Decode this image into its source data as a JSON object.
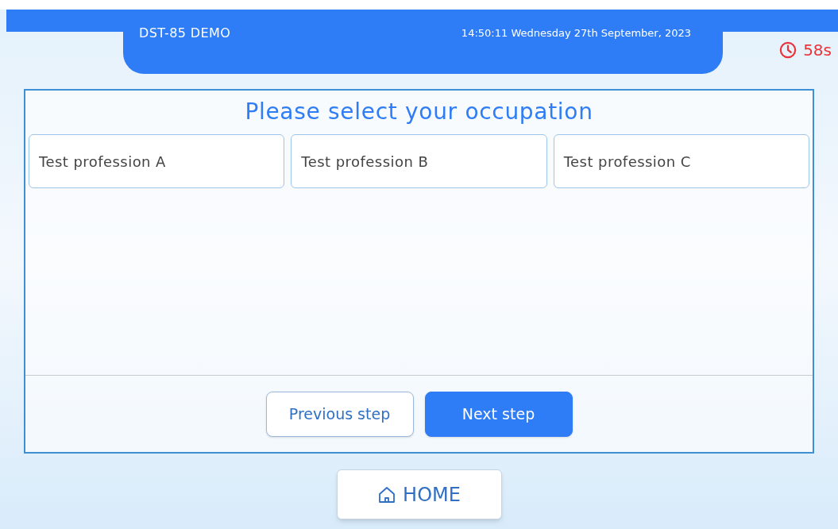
{
  "header": {
    "title": "DST-85 DEMO",
    "datetime": "14:50:11 Wednesday 27th September, 2023"
  },
  "timer": {
    "text": "58s"
  },
  "panel": {
    "title": "Please select your occupation",
    "options": [
      {
        "label": "Test profession A"
      },
      {
        "label": "Test profession B"
      },
      {
        "label": "Test profession C"
      }
    ],
    "buttons": [
      {
        "label": "Previous step",
        "kind": "secondary"
      },
      {
        "label": "Next step",
        "kind": "primary"
      }
    ]
  },
  "home": {
    "label": "HOME"
  }
}
